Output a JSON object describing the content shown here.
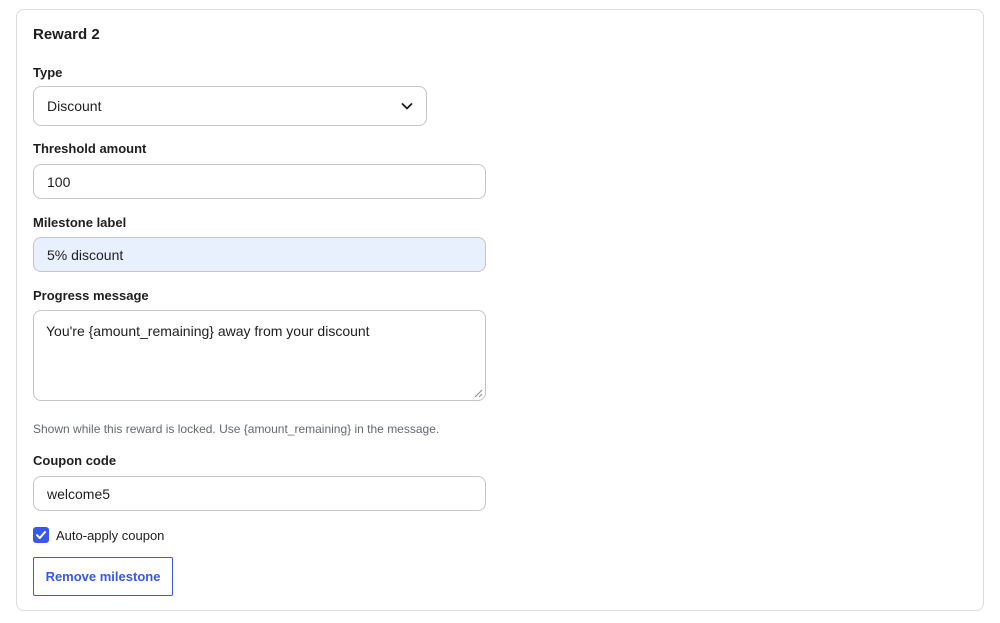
{
  "reward": {
    "title": "Reward 2",
    "type": {
      "label": "Type",
      "value": "Discount"
    },
    "threshold": {
      "label": "Threshold amount",
      "value": "100"
    },
    "milestone": {
      "label": "Milestone label",
      "value": "5% discount"
    },
    "progress": {
      "label": "Progress message",
      "value": "You're {amount_remaining} away from your discount",
      "help": "Shown while this reward is locked. Use {amount_remaining} in the message."
    },
    "coupon": {
      "label": "Coupon code",
      "value": "welcome5"
    },
    "auto_apply": {
      "label": "Auto-apply coupon",
      "checked": true
    },
    "remove_button": "Remove milestone"
  },
  "colors": {
    "accent": "#3858e9",
    "active_field": "#e8f0fe",
    "border": "#c3c4c7"
  }
}
